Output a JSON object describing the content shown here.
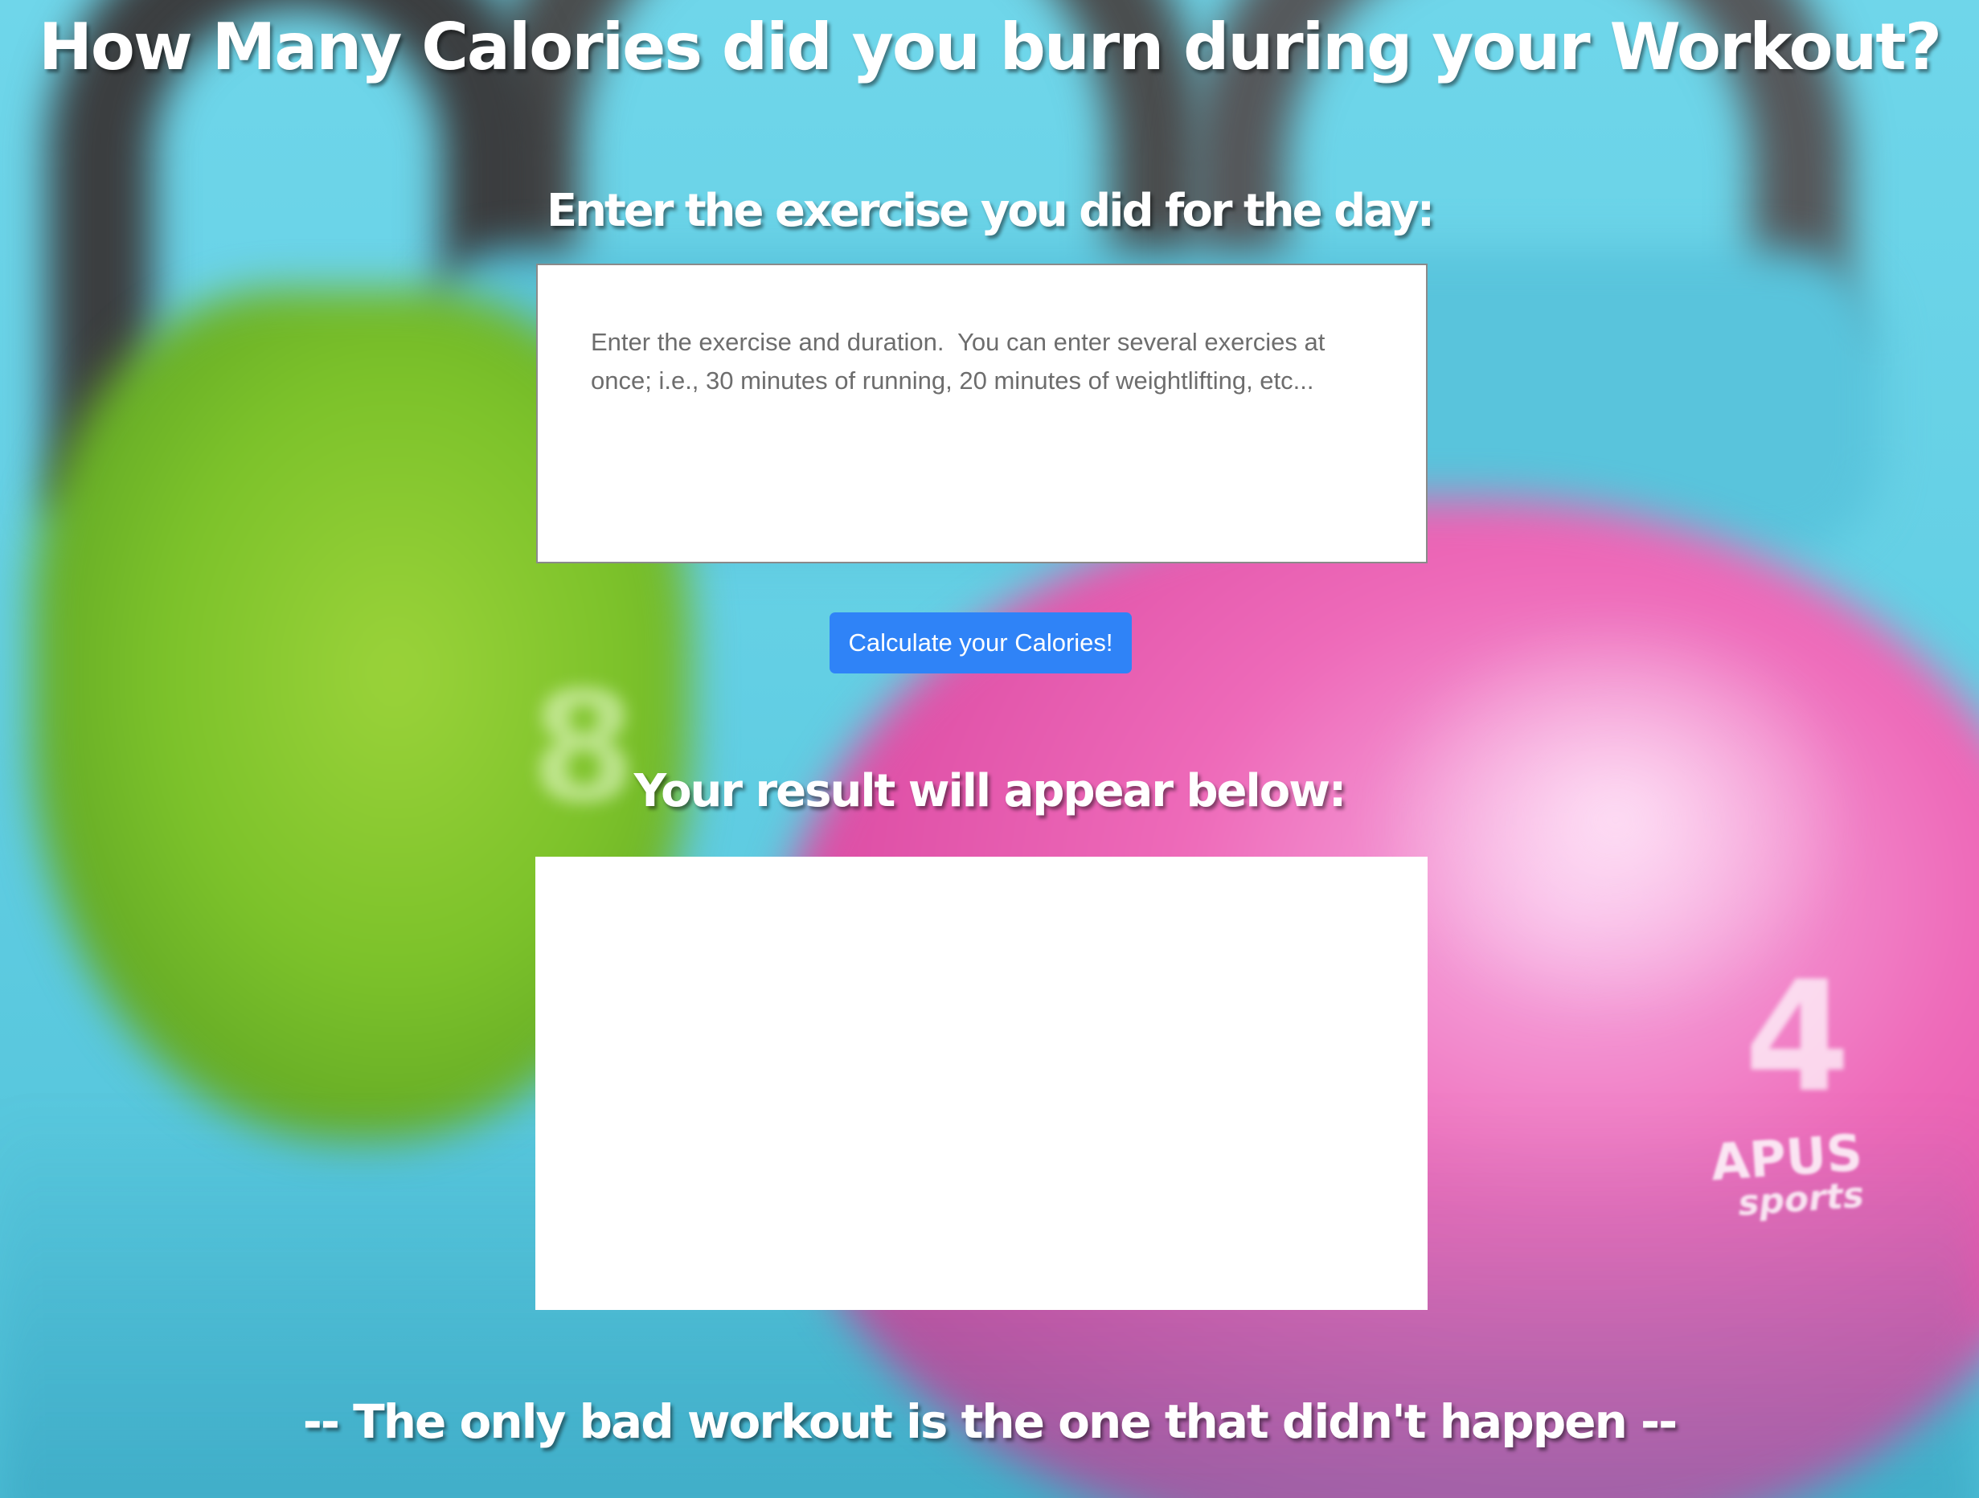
{
  "page": {
    "title": "How Many Calories did you burn during your Workout?",
    "exercise_heading": "Enter the exercise you did for the day:",
    "exercise_input": {
      "value": "",
      "placeholder": "Enter the exercise and duration.  You can enter several exercies at once; i.e., 30 minutes of running, 20 minutes of weightlifting, etc..."
    },
    "calculate_button_label": "Calculate your Calories!",
    "result_heading": "Your result will appear below:",
    "result_text": "",
    "quote": "-- The only bad workout is the one that didn't happen --"
  },
  "background": {
    "digits": [
      "8",
      "4"
    ],
    "brand": "APUS",
    "brand_sub": "sports",
    "colors": {
      "sky": "#63cfe4",
      "green_bell": "#7cc22a",
      "pink_bell": "#ee6ab9",
      "handle": "#3b3d3f"
    }
  },
  "colors": {
    "button": "#2f83f7",
    "heading_text": "#ffffff"
  }
}
